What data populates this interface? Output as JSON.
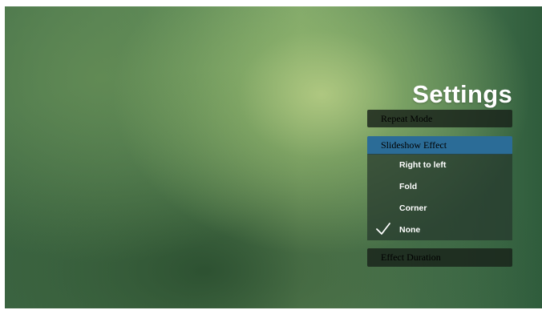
{
  "settings": {
    "title": "Settings",
    "menu": {
      "repeat_mode": "Repeat Mode",
      "slideshow_effect": "Slideshow Effect",
      "effect_duration": "Effect Duration"
    },
    "slideshow_options": [
      {
        "label": "Right to left",
        "checked": false
      },
      {
        "label": "Fold",
        "checked": false
      },
      {
        "label": "Corner",
        "checked": false
      },
      {
        "label": "None",
        "checked": true
      }
    ],
    "selected_option": "None",
    "colors": {
      "highlight": "#2b6c97",
      "menu_bg": "#18221a",
      "text": "#ffffff"
    }
  }
}
